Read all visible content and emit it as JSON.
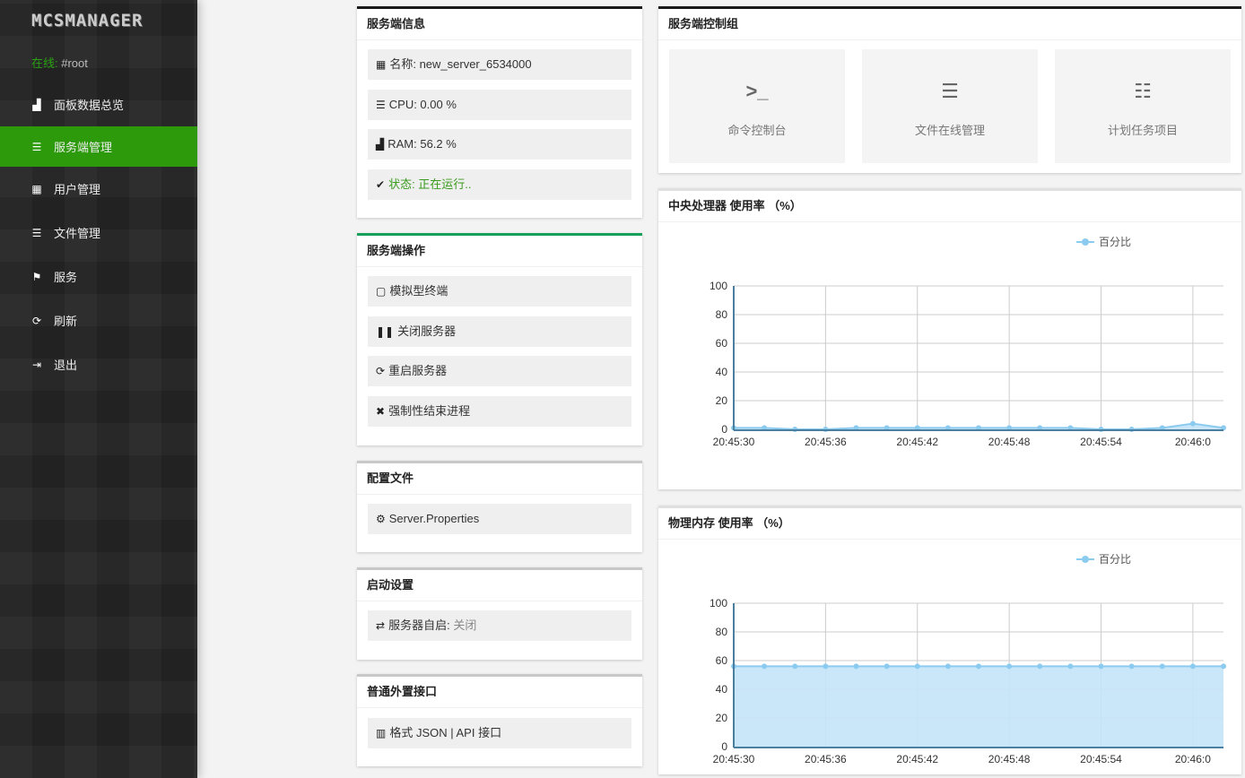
{
  "sidebar": {
    "logo": "MCSMANAGER",
    "online_label": "在线:",
    "online_user": "#root",
    "items": [
      {
        "label": "面板数据总览",
        "icon": "bar-chart-icon"
      },
      {
        "label": "服务端管理",
        "icon": "server-icon",
        "active": true
      },
      {
        "label": "用户管理",
        "icon": "users-grid-icon"
      },
      {
        "label": "文件管理",
        "icon": "list-icon"
      },
      {
        "label": "服务",
        "icon": "service-icon"
      },
      {
        "label": "刷新",
        "icon": "refresh-icon"
      },
      {
        "label": "退出",
        "icon": "logout-icon"
      }
    ]
  },
  "info": {
    "title": "服务端信息",
    "name": "名称: new_server_6534000",
    "cpu": "CPU: 0.00 %",
    "ram": "RAM: 56.2 %",
    "status": "状态: 正在运行.."
  },
  "ops": {
    "title": "服务端操作",
    "terminal": "模拟型终端",
    "stop": "关闭服务器",
    "restart": "重启服务器",
    "kill": "强制性结束进程"
  },
  "config": {
    "title": "配置文件",
    "properties": "Server.Properties"
  },
  "startup": {
    "title": "启动设置",
    "autostart_label": "服务器自启:",
    "autostart_value": "关闭"
  },
  "api": {
    "title": "普通外置接口",
    "label": "格式 JSON | API 接口"
  },
  "control": {
    "title": "服务端控制组",
    "tiles": [
      {
        "label": "命令控制台",
        "icon": "terminal-icon"
      },
      {
        "label": "文件在线管理",
        "icon": "list-icon"
      },
      {
        "label": "计划任务项目",
        "icon": "schedule-icon"
      }
    ]
  },
  "colors": {
    "accent": "#2c9a0a",
    "series": "#8ccbf0",
    "fill": "#c4e4f8"
  },
  "chart_data": [
    {
      "type": "area",
      "title": "中央处理器 使用率 （%）",
      "legend": "百分比",
      "ylim": [
        0,
        100
      ],
      "yticks": [
        0,
        20,
        40,
        60,
        80,
        100
      ],
      "xticks": [
        "20:45:30",
        "20:45:36",
        "20:45:42",
        "20:45:48",
        "20:45:54",
        "20:46:0"
      ],
      "x_seconds": [
        0,
        2,
        4,
        6,
        8,
        10,
        12,
        14,
        16,
        18,
        20,
        22,
        24,
        26,
        28,
        30,
        32
      ],
      "values": [
        1,
        1,
        0,
        0,
        1,
        1,
        1,
        1,
        1,
        1,
        1,
        1,
        0,
        0,
        1,
        4,
        1
      ]
    },
    {
      "type": "area",
      "title": "物理内存 使用率 （%）",
      "legend": "百分比",
      "ylim": [
        0,
        100
      ],
      "yticks": [
        0,
        20,
        40,
        60,
        80,
        100
      ],
      "xticks": [
        "20:45:30",
        "20:45:36",
        "20:45:42",
        "20:45:48",
        "20:45:54",
        "20:46:0"
      ],
      "x_seconds": [
        0,
        2,
        4,
        6,
        8,
        10,
        12,
        14,
        16,
        18,
        20,
        22,
        24,
        26,
        28,
        30,
        32
      ],
      "values": [
        56,
        56,
        56,
        56,
        56,
        56,
        56,
        56,
        56,
        56,
        56,
        56,
        56,
        56,
        56,
        56,
        56
      ]
    }
  ]
}
